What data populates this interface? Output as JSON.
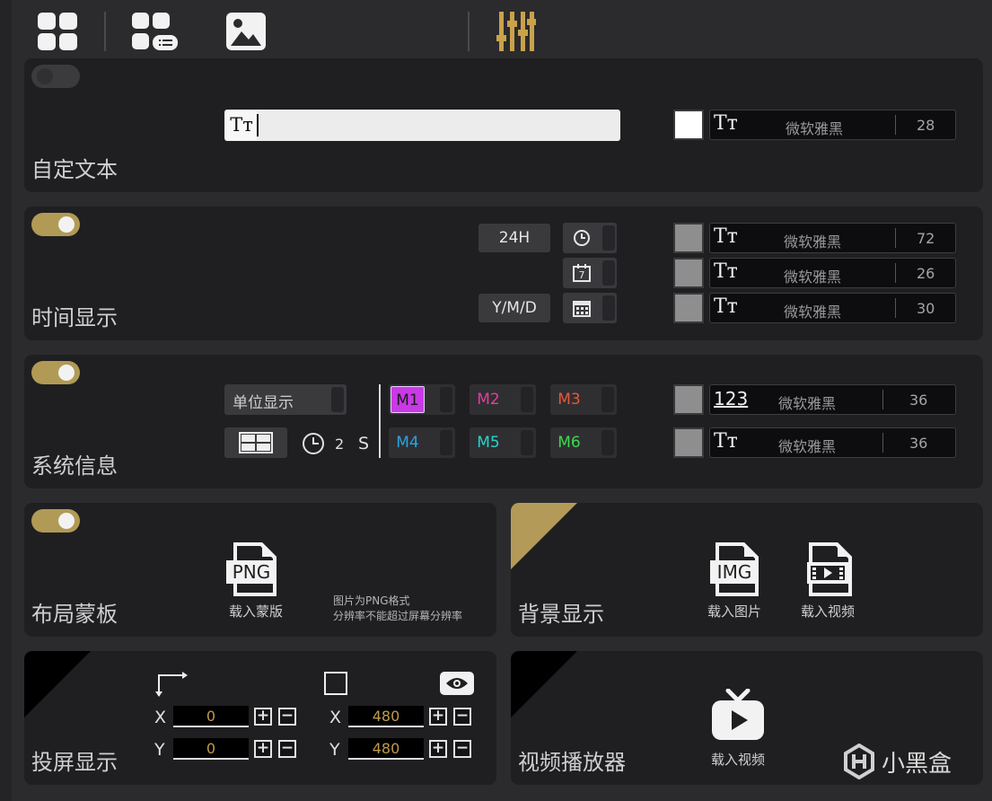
{
  "toolbar": {
    "icons": [
      "grid-icon",
      "grid-list-icon",
      "image-icon",
      "sliders-icon"
    ],
    "accent_color": "#c9a24a"
  },
  "custom_text": {
    "title": "自定文本",
    "enabled": false,
    "input_value": "",
    "input_icon": "Tт",
    "color": "#ffffff",
    "font": {
      "icon": "Tт",
      "name": "微软雅黑",
      "size": "28"
    }
  },
  "time_display": {
    "title": "时间显示",
    "enabled": true,
    "format_24h": "24H",
    "date_format": "Y/M/D",
    "rows": [
      {
        "icon": "clock-icon",
        "color": "#8e8e8e",
        "font_icon": "Tт",
        "font_name": "微软雅黑",
        "size": "72"
      },
      {
        "icon": "calendar-day-icon",
        "day": "7",
        "color": "#8e8e8e",
        "font_icon": "Tт",
        "font_name": "微软雅黑",
        "size": "26"
      },
      {
        "icon": "calendar-grid-icon",
        "color": "#8e8e8e",
        "font_icon": "Tт",
        "font_name": "微软雅黑",
        "size": "30"
      }
    ]
  },
  "system_info": {
    "title": "系统信息",
    "enabled": true,
    "unit_display": "单位显示",
    "interval_value": "2",
    "interval_unit": "S",
    "monitors": [
      {
        "label": "M1",
        "color": "#d13cf0",
        "active": true
      },
      {
        "label": "M2",
        "color": "#e0409a",
        "active": false
      },
      {
        "label": "M3",
        "color": "#e8583a",
        "active": false
      },
      {
        "label": "M4",
        "color": "#2aa3e0",
        "active": false
      },
      {
        "label": "M5",
        "color": "#28d4c8",
        "active": false
      },
      {
        "label": "M6",
        "color": "#3fd84f",
        "active": false
      }
    ],
    "rows": [
      {
        "font_icon": "123",
        "font_name": "微软雅黑",
        "size": "36",
        "color": "#8e8e8e"
      },
      {
        "font_icon": "Tт",
        "font_name": "微软雅黑",
        "size": "36",
        "color": "#8e8e8e"
      }
    ]
  },
  "layout_mask": {
    "title": "布局蒙板",
    "enabled": true,
    "file_icon_text": "PNG",
    "load_label": "载入蒙版",
    "note_line1": "图片为PNG格式",
    "note_line2": "分辨率不能超过屏幕分辨率"
  },
  "background_display": {
    "title": "背景显示",
    "load_image_label": "载入图片",
    "load_video_label": "载入视频",
    "img_icon_text": "IMG"
  },
  "cast_display": {
    "title": "投屏显示",
    "position": {
      "x_label": "X",
      "y_label": "Y",
      "x": "0",
      "y": "0"
    },
    "size": {
      "x_label": "X",
      "y_label": "Y",
      "x": "480",
      "y": "480"
    },
    "plus": "+",
    "minus": "−"
  },
  "video_player": {
    "title": "视频播放器",
    "load_video_label": "载入视频"
  },
  "watermark": {
    "text": "小黑盒"
  }
}
